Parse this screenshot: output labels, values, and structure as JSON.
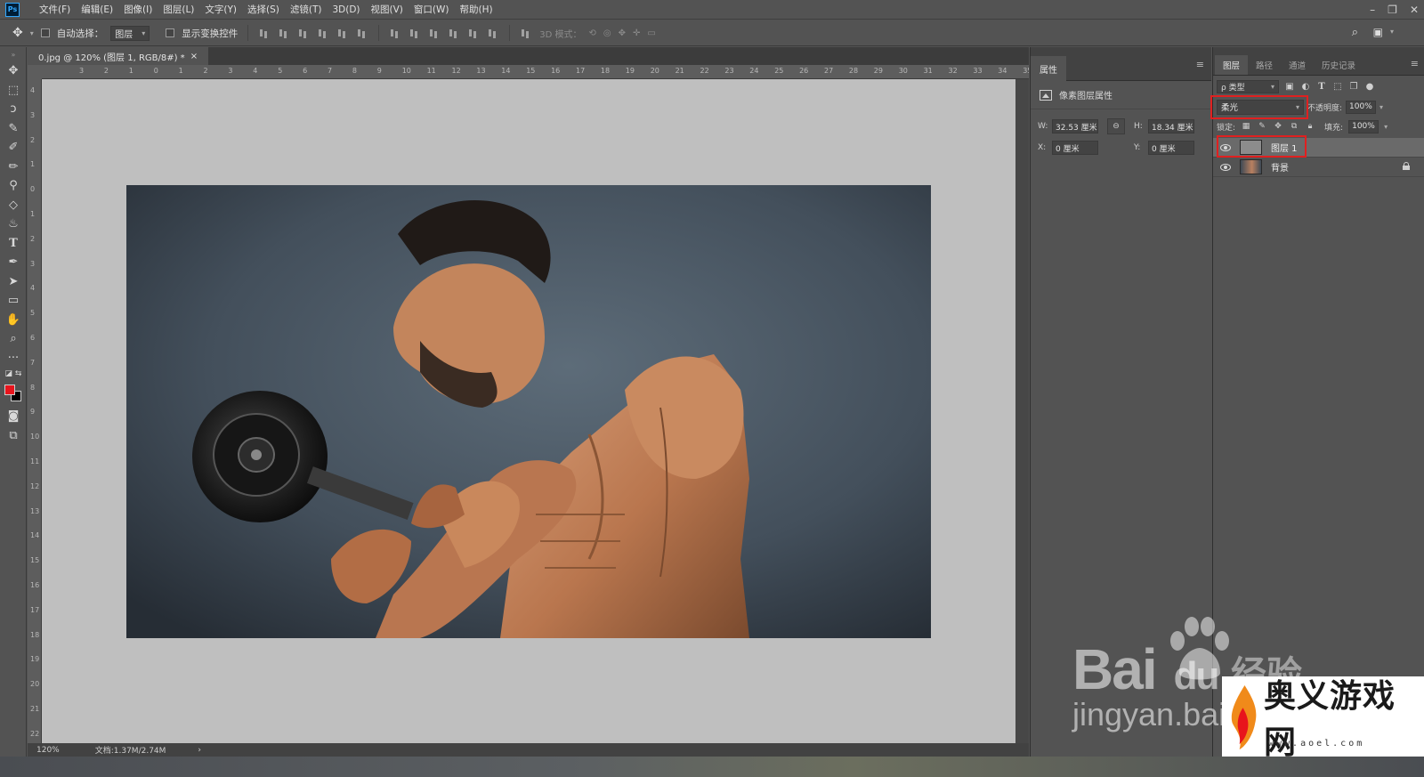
{
  "menu": {
    "app_icon_label": "Ps",
    "items": [
      "文件(F)",
      "编辑(E)",
      "图像(I)",
      "图层(L)",
      "文字(Y)",
      "选择(S)",
      "滤镜(T)",
      "3D(D)",
      "视图(V)",
      "窗口(W)",
      "帮助(H)"
    ],
    "window_controls": [
      "–",
      "❐",
      "✕"
    ]
  },
  "options": {
    "auto_select_label": "自动选择：",
    "auto_select_value": "图层",
    "show_transform_label": "显示变换控件",
    "mode_3d_label": "3D 模式："
  },
  "document": {
    "tab_title": "0.jpg @ 120% (图层 1, RGB/8#) *",
    "close_glyph": "×",
    "ruler_top_labels": [
      "3",
      "2",
      "1",
      "0",
      "1",
      "2",
      "3",
      "4",
      "5",
      "6",
      "7",
      "8",
      "9",
      "10",
      "11",
      "12",
      "13",
      "14",
      "15",
      "16",
      "17",
      "18",
      "19",
      "20",
      "21",
      "22",
      "23",
      "24",
      "25",
      "26",
      "27",
      "28",
      "29",
      "30",
      "31",
      "32",
      "33",
      "34",
      "35"
    ],
    "ruler_left_labels": [
      "4",
      "3",
      "2",
      "1",
      "0",
      "1",
      "2",
      "3",
      "4",
      "5",
      "6",
      "7",
      "8",
      "9",
      "10",
      "11",
      "12",
      "13",
      "14",
      "15",
      "16",
      "17",
      "18",
      "19",
      "20",
      "21",
      "22"
    ],
    "status_zoom": "120%",
    "status_doc": "文档:1.37M/2.74M",
    "status_arrow": "›"
  },
  "properties": {
    "tab_label": "属性",
    "subtitle": "像素图层属性",
    "w_label": "W:",
    "w_value": "32.53 厘米",
    "h_label": "H:",
    "h_value": "18.34 厘米",
    "x_label": "X:",
    "x_value": "0 厘米",
    "y_label": "Y:",
    "y_value": "0 厘米",
    "menu_glyph": "≡",
    "link_glyph": "⊖"
  },
  "layers": {
    "tabs": [
      "图层",
      "路径",
      "通道",
      "历史记录"
    ],
    "menu_glyph": "≡",
    "filter_value": "ρ 类型",
    "blend_mode": "柔光",
    "opacity_label": "不透明度:",
    "opacity_value": "100%",
    "lock_label": "锁定:",
    "fill_label": "填充:",
    "fill_value": "100%",
    "items": [
      {
        "name": "图层 1",
        "selected": true
      },
      {
        "name": "背景",
        "selected": false
      }
    ]
  },
  "watermarks": {
    "baidu": "Bai",
    "baidu_du": "du",
    "baidu_cn": "经验",
    "baidu_url": "jingyan.baidu",
    "aoyi": "奥义游戏网",
    "aoyi_url": "www.aoel.com"
  },
  "colors": {
    "foreground": "#e8141c",
    "background": "#000000",
    "highlight": "#e02020"
  }
}
